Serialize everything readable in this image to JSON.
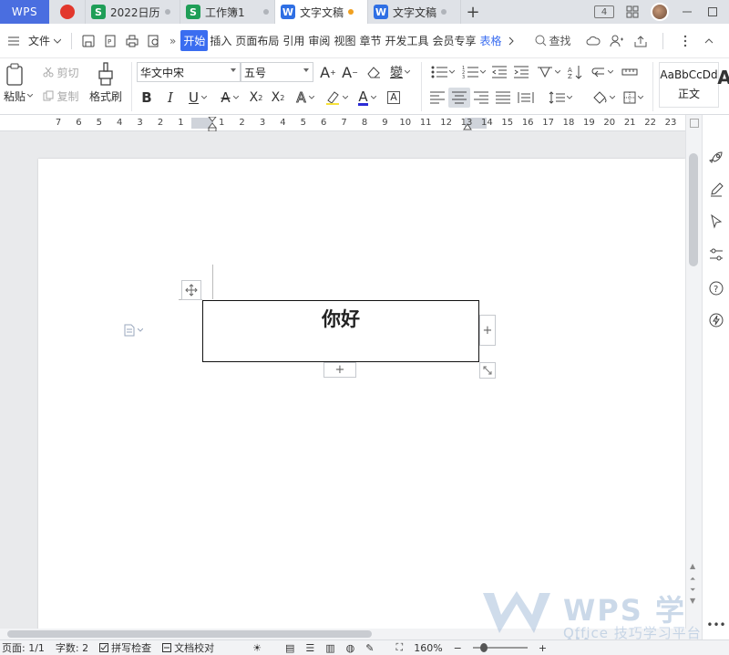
{
  "tabbar": {
    "app_label": "WPS",
    "tabs": [
      {
        "label": "2022日历",
        "icon": "sheet-icon",
        "icon_text": "S"
      },
      {
        "label": "工作簿1",
        "icon": "sheet-icon",
        "icon_text": "S"
      },
      {
        "label": "文字文稿",
        "icon": "doc-icon",
        "icon_text": "W",
        "active": true
      },
      {
        "label": "文字文稿",
        "icon": "doc-icon",
        "icon_text": "W"
      }
    ],
    "add_tab": "+",
    "badge_count": "4"
  },
  "menubar": {
    "file_label": "文件",
    "tabs": [
      "开始",
      "插入",
      "页面布局",
      "引用",
      "审阅",
      "视图",
      "章节",
      "开发工具",
      "会员专享",
      "表格"
    ],
    "active_tab": "开始",
    "search_label": "查找",
    "more": "»"
  },
  "ribbon": {
    "paste_label": "粘贴",
    "cut_label": "剪切",
    "copy_label": "复制",
    "format_painter_label": "格式刷",
    "font_name": "华文中宋",
    "font_size": "五号",
    "style_preview": "AaBbCcDd",
    "style_name": "正文"
  },
  "ruler": {
    "ticks": [
      "7",
      "6",
      "5",
      "4",
      "3",
      "2",
      "1",
      "1",
      "2",
      "3",
      "4",
      "5",
      "6",
      "7",
      "8",
      "9",
      "10",
      "11",
      "12",
      "13",
      "14",
      "15",
      "16",
      "17",
      "18",
      "19",
      "20",
      "21",
      "22",
      "23"
    ]
  },
  "document": {
    "textbox_text": "你好"
  },
  "statusbar": {
    "page": "页面: 1/1",
    "words": "字数: 2",
    "spell_check": "拼写检查",
    "proofread": "文档校对",
    "zoom": "160%"
  },
  "watermark": {
    "main": "WPS 学堂",
    "sub": "Office 技巧学习平台"
  },
  "colors": {
    "accent": "#3a6df0",
    "wps_logo": "#4a6ee0",
    "sheet_green": "#1f9e57",
    "doc_blue": "#2f6fe4",
    "pdf_red": "#e2372c",
    "unsaved_dot": "#f0a020"
  }
}
